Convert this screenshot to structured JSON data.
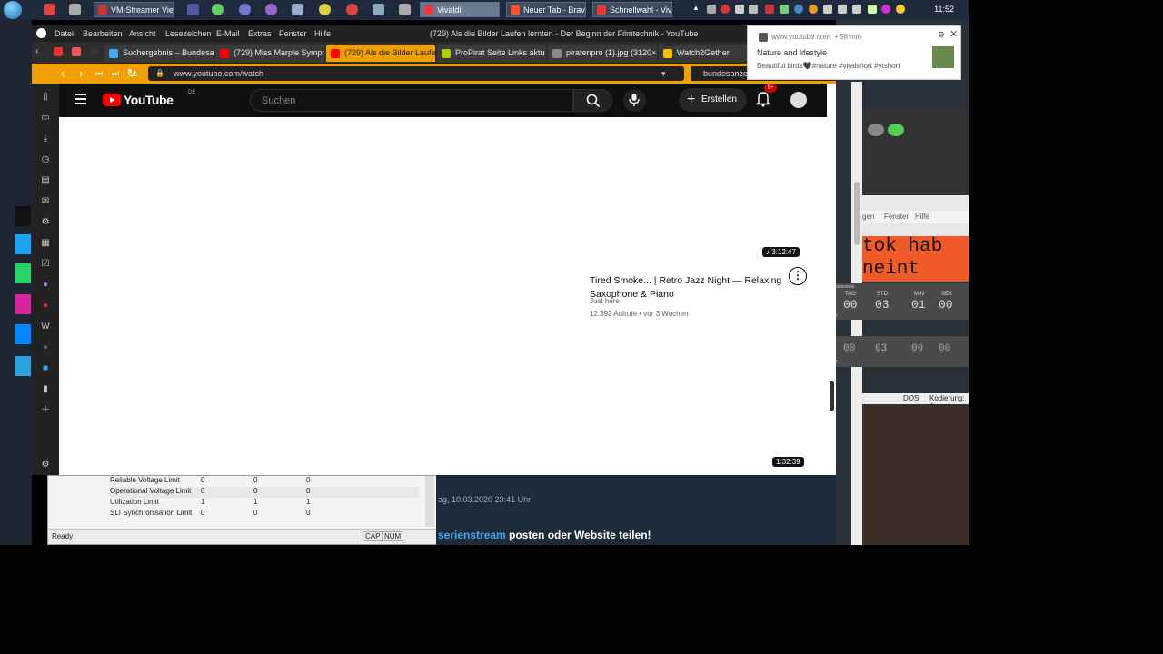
{
  "taskbar": {
    "tasks": [
      {
        "label": "VM-Streamer Vie...",
        "color": "#cc3333"
      },
      {
        "label": "Vivaldi",
        "color": "#ef3939"
      },
      {
        "label": "Neuer Tab - Brave",
        "color": "#fb542b"
      },
      {
        "label": "Schnellwahl - Viv...",
        "color": "#ef3939"
      }
    ],
    "clock": "11:52"
  },
  "menubar": {
    "items": [
      "Datei",
      "Bearbeiten",
      "Ansicht",
      "Lesezeichen",
      "E-Mail",
      "Extras",
      "Fenster",
      "Hilfe"
    ],
    "title": "(729) Als die Bilder Laufen lernten - Der Beginn der Filmtechnik - YouTube"
  },
  "tabs": [
    {
      "label": "Suchergebnis – Bundesanze",
      "color": "#3fa9f5"
    },
    {
      "label": "(729) Miss Marple Sympho",
      "color": "#ff0000"
    },
    {
      "label": "(729) Als die Bilder Laufen",
      "color": "#ff0000"
    },
    {
      "label": "ProPirat Seite Links aktu",
      "color": "#aacc00"
    },
    {
      "label": "piratenpro (1).jpg (3120×4",
      "color": "#888888"
    },
    {
      "label": "Watch2Gether",
      "color": "#f5c400"
    }
  ],
  "address": {
    "url": "www.youtube.com/watch",
    "bookmark": "bundesanze"
  },
  "youtube": {
    "logo": "YouTube",
    "region": "DE",
    "search_placeholder": "Suchen",
    "create_label": "Erstellen",
    "notif_count": "9+",
    "video": {
      "duration": "3:12:47",
      "title": "Tired Smoke... | Retro Jazz Night — Relaxing Saxophone & Piano",
      "channel": "Just here",
      "stats": "12.392 Aufrufe • vor 3 Wochen"
    },
    "duration2": "1:32:39"
  },
  "notification": {
    "source": "www.youtube.com",
    "time": "58 min",
    "title": "Nature and lifestyle",
    "body": "Beautiful birds🖤#nature #viralshort #ytshort"
  },
  "bg_table": {
    "rows": [
      {
        "name": "Reliable Voltage Limit",
        "a": "0",
        "b": "0",
        "c": "0"
      },
      {
        "name": "Operational Voltage Limit",
        "a": "0",
        "b": "0",
        "c": "0"
      },
      {
        "name": "Utilization Limit",
        "a": "1",
        "b": "1",
        "c": "1"
      },
      {
        "name": "SLI Synchronisation Limit",
        "a": "0",
        "b": "0",
        "c": "0"
      }
    ],
    "status": "Ready",
    "cap": "CAP",
    "num": "NUM"
  },
  "bg_forum": {
    "date": "ag, 10.03.2020 23:41 Uhr",
    "link": "serienstream",
    "rest": " posten oder Website teilen!"
  },
  "bg_editor": {
    "menu": [
      "gen",
      "Fenster",
      "Hilfe"
    ],
    "line1": "tok hab",
    "line2": "neint",
    "status_dos": "DOS",
    "status_enc": "Kodierung: A"
  },
  "timer": {
    "title": "russerseite",
    "labels": [
      "TAG",
      "STD",
      "MIN",
      "SEK"
    ],
    "values": [
      "00",
      "03",
      "01",
      "00"
    ],
    "values2": [
      "00",
      "03",
      "00",
      "00"
    ]
  }
}
